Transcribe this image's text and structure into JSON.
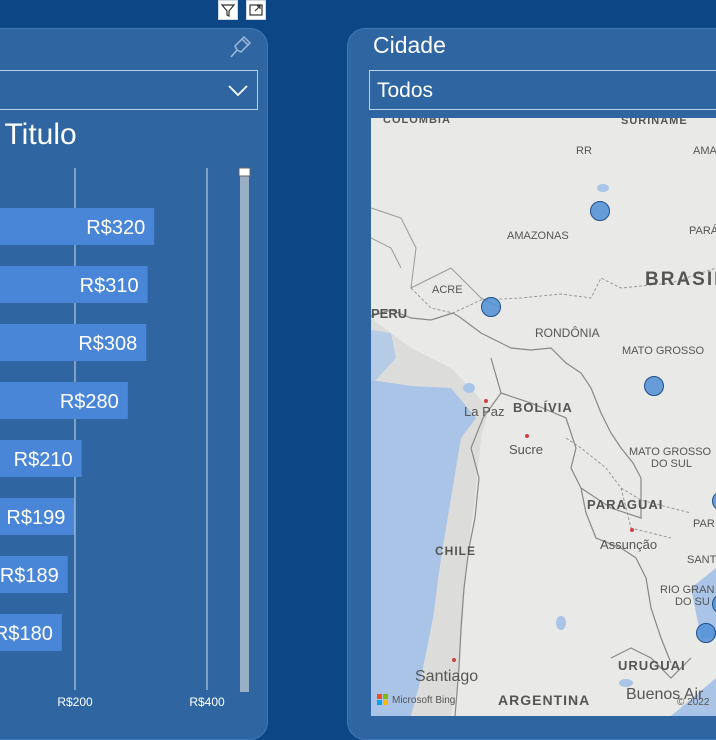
{
  "toolbar": {
    "filter_icon": "filter-icon",
    "focus_icon": "focus-mode-icon"
  },
  "left_panel": {
    "pin_icon": "pin-icon",
    "dropdown_chevron_icon": "chevron-down-icon",
    "chart_title": "or Titulo"
  },
  "right_panel": {
    "filter_label": "Cidade",
    "dropdown_value": "Todos"
  },
  "map": {
    "labels": {
      "colombia": "COLÔMBIA",
      "suriname": "SURINAME",
      "rr": "RR",
      "ama": "AMA",
      "amazonas": "AMAZONAS",
      "para": "PARÁ",
      "brasil": "BRASIL",
      "acre": "ACRE",
      "peru": "PERU",
      "rondonia": "RONDÔNIA",
      "mato_grosso": "MATO GROSSO",
      "la_paz": "La Paz",
      "bolivia": "BOLÍVIA",
      "sucre": "Sucre",
      "mato_grosso_do_sul_1": "MATO GROSSO",
      "mato_grosso_do_sul_2": "DO SUL",
      "paraguai": "PARAGUAI",
      "par": "PAR",
      "assuncao": "Assunção",
      "chile": "CHILE",
      "sant": "SANT",
      "rio_grande_1": "RIO GRAN",
      "rio_grande_2": "DO SU",
      "uruguai": "URUGUAI",
      "santiago": "Santiago",
      "argentina": "ARGENTINA",
      "buenos_aires": "Buenos Air",
      "attribution": "Microsoft Bing",
      "copyright": "© 2022"
    },
    "bubble_color": "#4f8fd6"
  },
  "chart_data": {
    "type": "bar",
    "orientation": "horizontal",
    "title": "or Titulo",
    "values": [
      320,
      310,
      308,
      280,
      210,
      199,
      189,
      180
    ],
    "data_labels": [
      "R$320",
      "R$310",
      "R$308",
      "R$280",
      "R$210",
      "R$199",
      "R$189",
      "R$180"
    ],
    "x_ticks": [
      "R$200",
      "R$400"
    ],
    "bar_color": "#4a86d8"
  }
}
